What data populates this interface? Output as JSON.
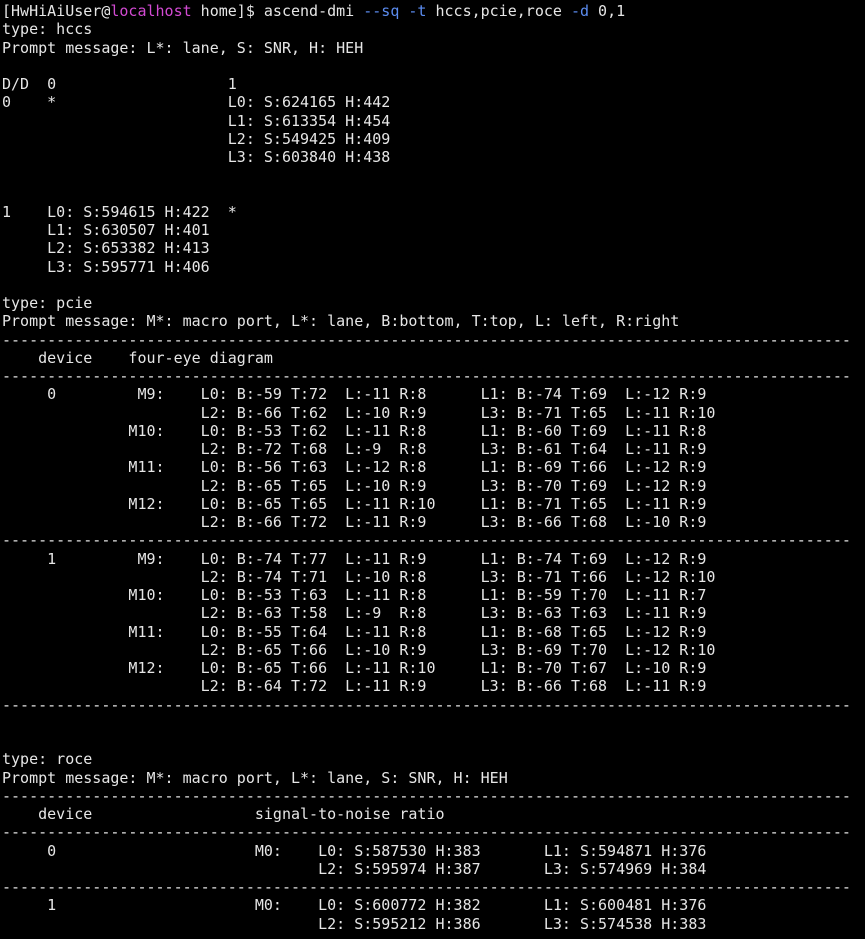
{
  "terminal": {
    "prompt": {
      "bracket_open": "[",
      "user": "HwHiAiUser@",
      "host": "localhost",
      "path_end": " home]$ ",
      "cmd": "ascend-dmi ",
      "opt_sq": "--sq",
      "sp1": " ",
      "opt_t": "-t",
      "types": " hccs,pcie,roce ",
      "opt_d": "-d",
      "devs": " 0,1"
    },
    "lines": [
      "type: hccs",
      "Prompt message: L*: lane, S: SNR, H: HEH",
      "",
      "D/D  0                   1",
      "0    *                   L0: S:624165 H:442",
      "                         L1: S:613354 H:454",
      "                         L2: S:549425 H:409",
      "                         L3: S:603840 H:438",
      "",
      "",
      "1    L0: S:594615 H:422  *",
      "     L1: S:630507 H:401",
      "     L2: S:653382 H:413",
      "     L3: S:595771 H:406",
      "",
      "type: pcie",
      "Prompt message: M*: macro port, L*: lane, B:bottom, T:top, L: left, R:right",
      "----------------------------------------------------------------------------------------------",
      "    device    four-eye diagram",
      "----------------------------------------------------------------------------------------------",
      "     0         M9:    L0: B:-59 T:72  L:-11 R:8      L1: B:-74 T:69  L:-12 R:9",
      "                      L2: B:-66 T:62  L:-10 R:9      L3: B:-71 T:65  L:-11 R:10",
      "              M10:    L0: B:-53 T:62  L:-11 R:8      L1: B:-60 T:69  L:-11 R:8",
      "                      L2: B:-72 T:68  L:-9  R:8      L3: B:-61 T:64  L:-11 R:9",
      "              M11:    L0: B:-56 T:63  L:-12 R:8      L1: B:-69 T:66  L:-12 R:9",
      "                      L2: B:-65 T:65  L:-10 R:9      L3: B:-70 T:69  L:-12 R:9",
      "              M12:    L0: B:-65 T:65  L:-11 R:10     L1: B:-71 T:65  L:-11 R:9",
      "                      L2: B:-66 T:72  L:-11 R:9      L3: B:-66 T:68  L:-10 R:9",
      "----------------------------------------------------------------------------------------------",
      "     1         M9:    L0: B:-74 T:77  L:-11 R:9      L1: B:-74 T:69  L:-12 R:9",
      "                      L2: B:-74 T:71  L:-10 R:8      L3: B:-71 T:66  L:-12 R:10",
      "              M10:    L0: B:-53 T:63  L:-11 R:8      L1: B:-59 T:70  L:-11 R:7",
      "                      L2: B:-63 T:58  L:-9  R:8      L3: B:-63 T:63  L:-11 R:9",
      "              M11:    L0: B:-55 T:64  L:-11 R:8      L1: B:-68 T:65  L:-12 R:9",
      "                      L2: B:-65 T:66  L:-10 R:9      L3: B:-69 T:70  L:-12 R:10",
      "              M12:    L0: B:-65 T:66  L:-11 R:10     L1: B:-70 T:67  L:-10 R:9",
      "                      L2: B:-64 T:72  L:-11 R:9      L3: B:-66 T:68  L:-11 R:9",
      "----------------------------------------------------------------------------------------------",
      "",
      "",
      "type: roce",
      "Prompt message: M*: macro port, L*: lane, S: SNR, H: HEH",
      "----------------------------------------------------------------------------------------------",
      "    device                  signal-to-noise ratio",
      "----------------------------------------------------------------------------------------------",
      "     0                      M0:    L0: S:587530 H:383       L1: S:594871 H:376",
      "                                   L2: S:595974 H:387       L3: S:574969 H:384",
      "----------------------------------------------------------------------------------------------",
      "     1                      M0:    L0: S:600772 H:382       L1: S:600481 H:376",
      "                                   L2: S:595212 H:386       L3: S:574538 H:383",
      "----------------------------------------------------------------------------------------------"
    ]
  }
}
